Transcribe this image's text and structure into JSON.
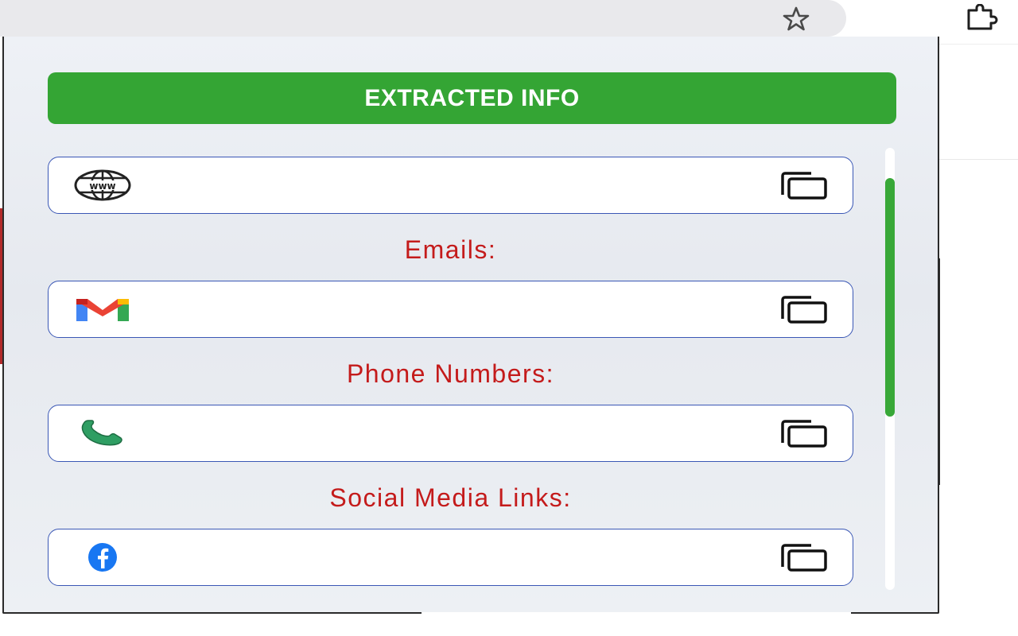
{
  "browser": {
    "bookmark_icon": "star-icon",
    "extensions_icon": "puzzle-icon"
  },
  "popup": {
    "header": {
      "title": "EXTRACTED INFO",
      "color": "#34a534"
    },
    "fields": {
      "website": {
        "icon": "globe-www-icon",
        "value": ""
      },
      "email": {
        "label": "Emails:",
        "icon": "gmail-icon",
        "value": ""
      },
      "phone": {
        "label": "Phone Numbers:",
        "icon": "phone-icon",
        "value": ""
      },
      "social": {
        "label": "Social Media Links:",
        "icon": "facebook-icon",
        "value": ""
      }
    },
    "copy_icon": "copy-icon",
    "colors": {
      "label": "#c41b1b",
      "field_border": "#3a57b5",
      "scroll_thumb": "#38a838"
    }
  }
}
